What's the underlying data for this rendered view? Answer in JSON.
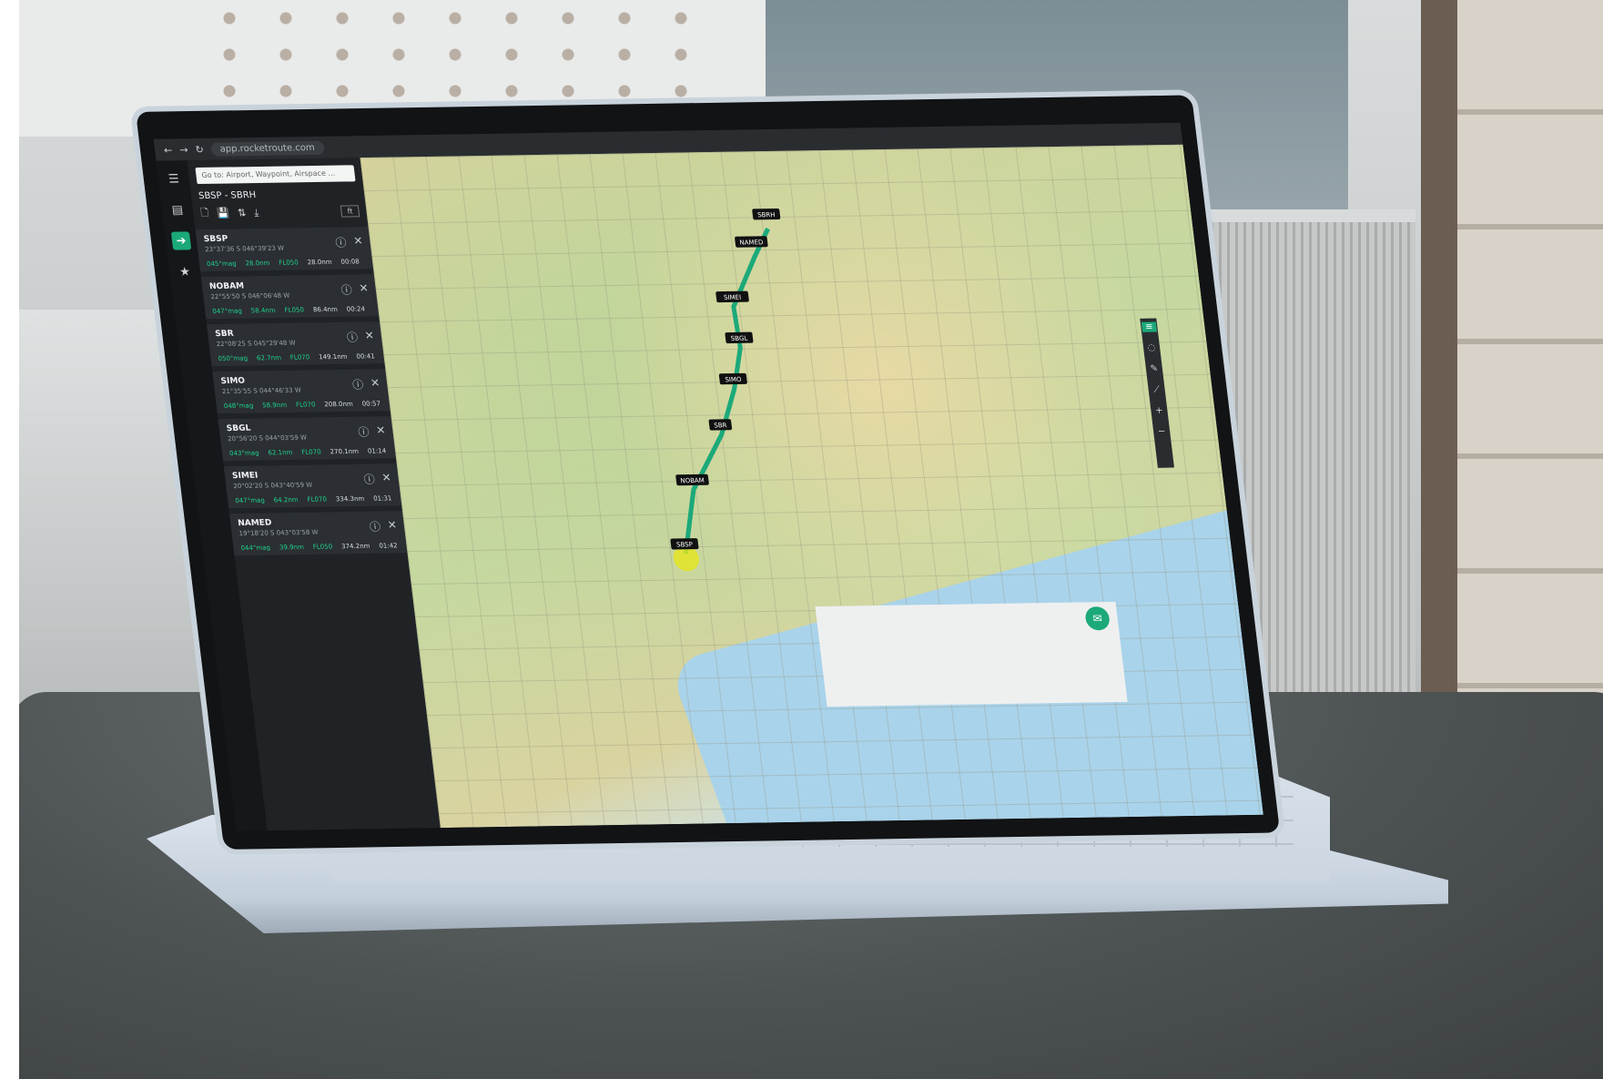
{
  "browser": {
    "url": "app.rocketroute.com"
  },
  "route": {
    "title": "SBSP - SBRH"
  },
  "search": {
    "placeholder": "Go to: Airport, Waypoint, Airspace ..."
  },
  "toolbar": {
    "box_label": "ft"
  },
  "waypoints": [
    {
      "name": "SBSP",
      "sub": "23°37'36 S 046°39'23 W",
      "legs": [
        "045°mag",
        "28.0nm",
        "FL050",
        "28.0nm",
        "00:08"
      ]
    },
    {
      "name": "NOBAM",
      "sub": "22°55'50 S 046°06'48 W",
      "legs": [
        "047°mag",
        "58.4nm",
        "FL050",
        "86.4nm",
        "00:24"
      ]
    },
    {
      "name": "SBR",
      "sub": "22°08'25 S 045°29'48 W",
      "legs": [
        "050°mag",
        "62.7nm",
        "FL070",
        "149.1nm",
        "00:41"
      ]
    },
    {
      "name": "SIMO",
      "sub": "21°35'55 S 044°46'33 W",
      "legs": [
        "048°mag",
        "58.9nm",
        "FL070",
        "208.0nm",
        "00:57"
      ]
    },
    {
      "name": "SBGL",
      "sub": "20°56'20 S 044°03'59 W",
      "legs": [
        "043°mag",
        "62.1nm",
        "FL070",
        "270.1nm",
        "01:14"
      ]
    },
    {
      "name": "SIMEI",
      "sub": "20°02'20 S 043°40'59 W",
      "legs": [
        "047°mag",
        "64.2nm",
        "FL070",
        "334.3nm",
        "01:31"
      ]
    },
    {
      "name": "NAMED",
      "sub": "19°18'20 S 043°03'58 W",
      "legs": [
        "044°mag",
        "39.9nm",
        "FL050",
        "374.2nm",
        "01:42"
      ]
    }
  ],
  "map_labels": [
    "SBRH",
    "NAMED",
    "SIMEI",
    "SBGL",
    "SIMO",
    "SBR",
    "NOBAM",
    "SBSP"
  ]
}
